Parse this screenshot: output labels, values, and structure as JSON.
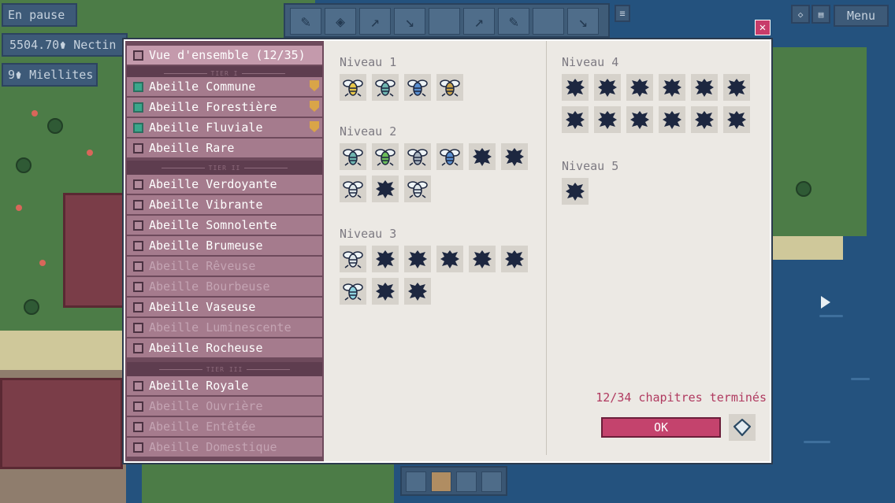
{
  "hud": {
    "pause_label": "En pause",
    "nectar": "5504.70⚱ Nectin",
    "mielites": "9⚱ Miellites",
    "menu_label": "Menu"
  },
  "dialog": {
    "close_label": "✕",
    "overview_label": "Vue d'ensemble (12/35)",
    "tiers": [
      "TIER I",
      "TIER II",
      "TIER III"
    ],
    "bees": [
      {
        "label": "Abeille Commune",
        "checked": true,
        "badge": true
      },
      {
        "label": "Abeille Forestière",
        "checked": true,
        "badge": true
      },
      {
        "label": "Abeille Fluviale",
        "checked": true,
        "badge": true
      },
      {
        "label": "Abeille Rare",
        "checked": false
      },
      {
        "label": "Abeille Verdoyante",
        "checked": false
      },
      {
        "label": "Abeille Vibrante",
        "checked": false
      },
      {
        "label": "Abeille Somnolente",
        "checked": false
      },
      {
        "label": "Abeille Brumeuse",
        "checked": false
      },
      {
        "label": "Abeille Rêveuse",
        "checked": false,
        "locked": true
      },
      {
        "label": "Abeille Bourbeuse",
        "checked": false,
        "locked": true
      },
      {
        "label": "Abeille Vaseuse",
        "checked": false
      },
      {
        "label": "Abeille Luminescente",
        "checked": false,
        "locked": true
      },
      {
        "label": "Abeille Rocheuse",
        "checked": false
      },
      {
        "label": "Abeille Royale",
        "checked": false
      },
      {
        "label": "Abeille Ouvrière",
        "checked": false,
        "locked": true
      },
      {
        "label": "Abeille Entêtée",
        "checked": false,
        "locked": true
      },
      {
        "label": "Abeille Domestique",
        "checked": false,
        "locked": true
      }
    ],
    "levels": [
      {
        "title": "Niveau 1",
        "bees": [
          "yellow",
          "teal",
          "blue",
          "gold"
        ]
      },
      {
        "title": "Niveau 2",
        "bees": [
          "teal",
          "green",
          "grey",
          "blue",
          "unknown",
          "unknown",
          "white",
          "unknown",
          "white"
        ]
      },
      {
        "title": "Niveau 3",
        "bees": [
          "white",
          "unknown",
          "unknown",
          "unknown",
          "unknown",
          "unknown",
          "cyan",
          "unknown",
          "unknown"
        ]
      },
      {
        "title": "Niveau 4",
        "bees": [
          "unknown",
          "unknown",
          "unknown",
          "unknown",
          "unknown",
          "unknown",
          "unknown",
          "unknown",
          "unknown",
          "unknown",
          "unknown",
          "unknown"
        ]
      },
      {
        "title": "Niveau 5",
        "bees": [
          "unknown"
        ]
      }
    ],
    "chapters_text": "12/34 chapitres terminés",
    "ok_label": "OK"
  },
  "colors": {
    "accent": "#c4436d",
    "sidebar": "#a57b8d",
    "check_on": "#3aa78b",
    "silhouette": "#1d2740"
  }
}
